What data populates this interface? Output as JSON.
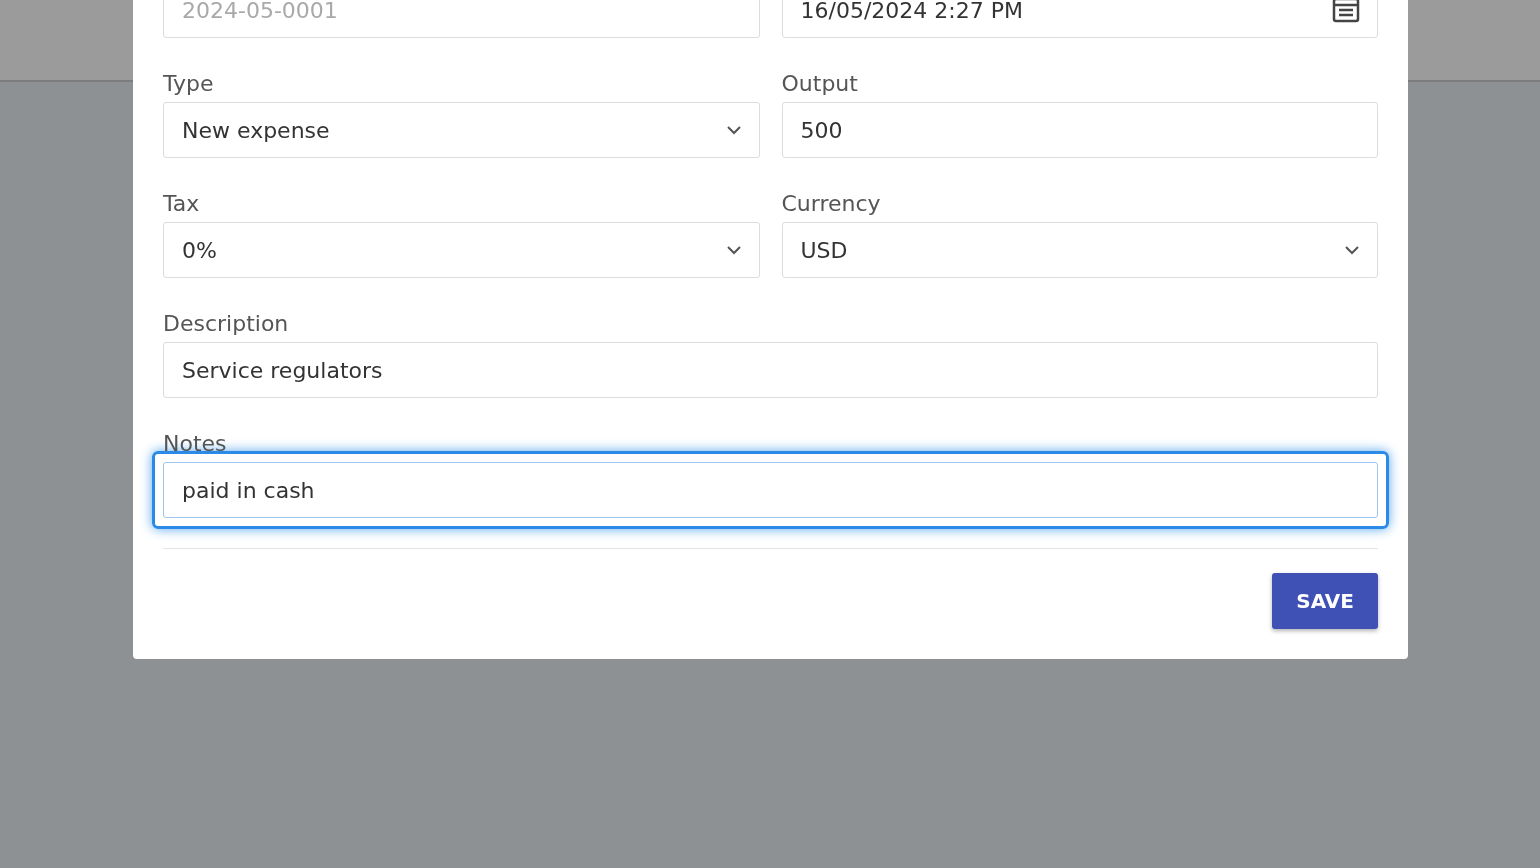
{
  "top_row": [
    {
      "kind": "text",
      "placeholder": "2024-05-0001"
    },
    {
      "kind": "datetime",
      "value": "16/05/2024 2:27 PM"
    }
  ],
  "fields": [
    {
      "label": "Type",
      "kind": "select",
      "value": "New expense",
      "wide": false,
      "focused": false
    },
    {
      "label": "Output",
      "kind": "text",
      "value": "500",
      "wide": false,
      "focused": false
    },
    {
      "label": "Tax",
      "kind": "select",
      "value": "0%",
      "wide": false,
      "focused": false
    },
    {
      "label": "Currency",
      "kind": "select",
      "value": "USD",
      "wide": false,
      "focused": false
    },
    {
      "label": "Description",
      "kind": "text",
      "value": "Service regulators",
      "wide": true,
      "focused": false
    },
    {
      "label": "Notes",
      "kind": "text",
      "value": "paid in cash",
      "wide": true,
      "focused": true
    }
  ],
  "save_button": "SAVE"
}
